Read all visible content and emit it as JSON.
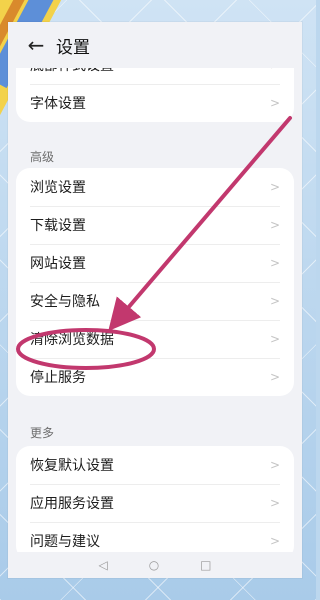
{
  "header": {
    "back_icon": "arrow-left-icon",
    "title": "设置"
  },
  "card1": {
    "items": [
      "底部样式设置",
      "字体设置"
    ]
  },
  "advanced": {
    "label": "高级",
    "items": [
      "浏览设置",
      "下载设置",
      "网站设置",
      "安全与隐私",
      "清除浏览数据",
      "停止服务"
    ]
  },
  "more": {
    "label": "更多",
    "items": [
      "恢复默认设置",
      "应用服务设置",
      "问题与建议"
    ]
  },
  "chevron_icon": "chevron-right-icon",
  "annotation": {
    "highlighted_item": "清除浏览数据",
    "arrow_color": "#c2386e"
  },
  "navbar": {
    "back": "◁",
    "home": "○",
    "recents": "□"
  }
}
